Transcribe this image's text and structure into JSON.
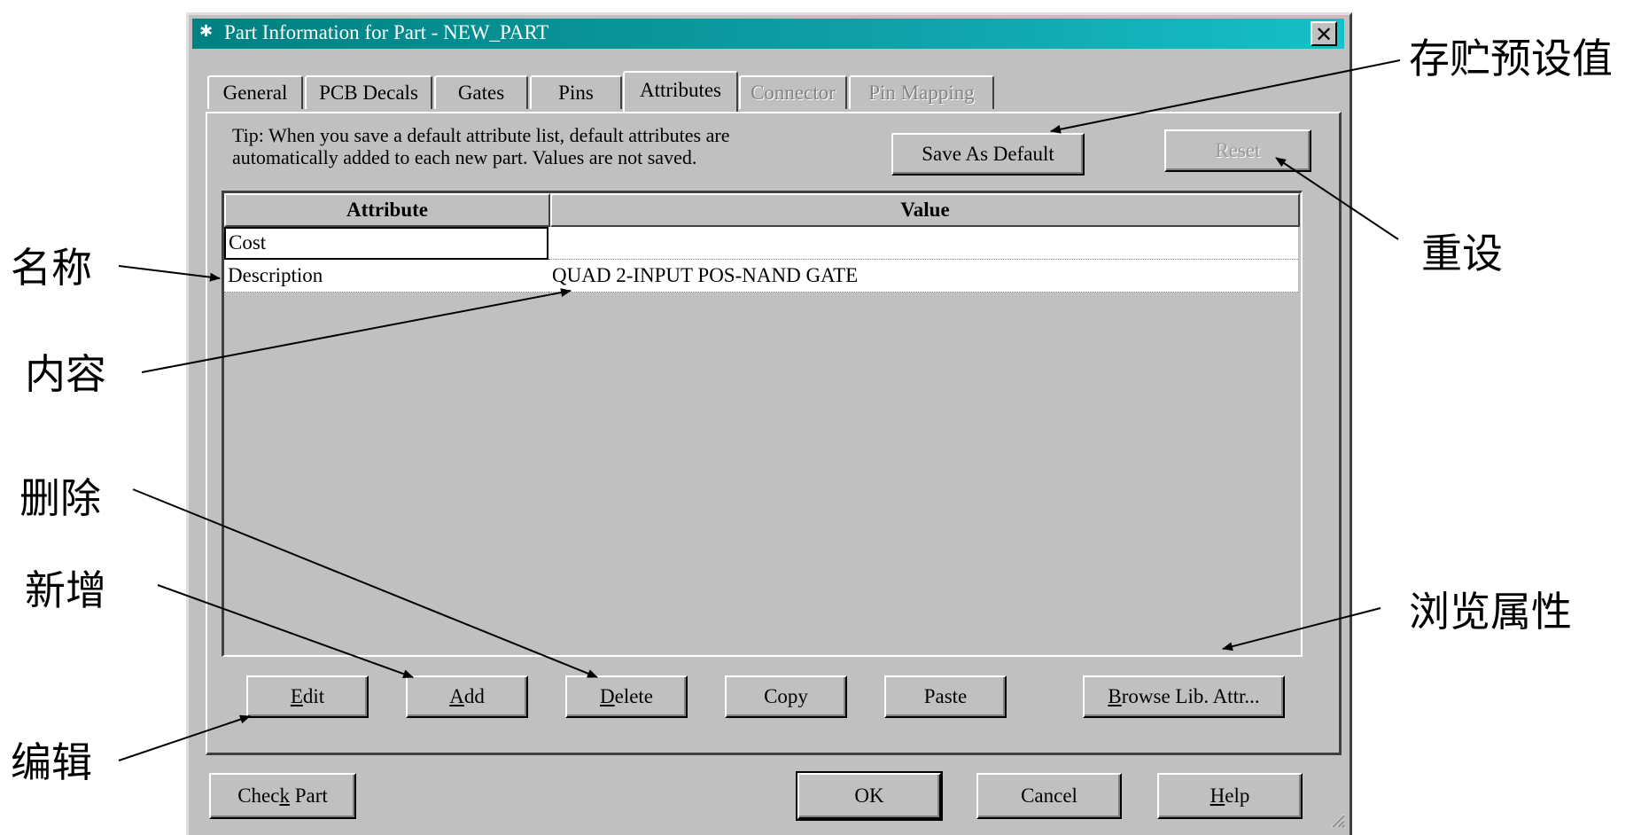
{
  "window": {
    "title": "Part Information for Part - NEW_PART",
    "close_glyph": "✕",
    "app_icon": "part-editor-icon"
  },
  "tabs": [
    {
      "label": "General",
      "state": "normal"
    },
    {
      "label": "PCB Decals",
      "state": "normal"
    },
    {
      "label": "Gates",
      "state": "normal"
    },
    {
      "label": "Pins",
      "state": "normal"
    },
    {
      "label": "Attributes",
      "state": "active"
    },
    {
      "label": "Connector",
      "state": "disabled"
    },
    {
      "label": "Pin Mapping",
      "state": "disabled"
    }
  ],
  "tip": {
    "line1": "Tip: When you save a default attribute list, default attributes are",
    "line2": "automatically added to each new part. Values are not saved."
  },
  "top_buttons": {
    "save_default": "Save As Default",
    "reset": "Reset"
  },
  "grid": {
    "columns": [
      "Attribute",
      "Value"
    ],
    "rows": [
      {
        "attribute": "Cost",
        "value": ""
      },
      {
        "attribute": "Description",
        "value": "QUAD 2-INPUT POS-NAND GATE"
      }
    ]
  },
  "actions": {
    "edit": {
      "mnemonic": "E",
      "rest": "dit"
    },
    "add": {
      "mnemonic": "A",
      "rest": "dd"
    },
    "delete": {
      "mnemonic": "D",
      "rest": "elete"
    },
    "copy": "Copy",
    "paste": "Paste",
    "browse": {
      "mnemonic": "B",
      "rest": "rowse Lib. Attr..."
    }
  },
  "footer": {
    "check_pre": "Chec",
    "check_mnemonic": "k",
    "check_post": " Part",
    "ok": "OK",
    "cancel": "Cancel",
    "help": {
      "mnemonic": "H",
      "rest": "elp"
    }
  },
  "annotations": {
    "save_default": "存贮预设值",
    "reset": "重设",
    "name": "名称",
    "content": "内容",
    "delete": "删除",
    "add": "新增",
    "browse": "浏览属性",
    "edit": "编辑"
  },
  "colors": {
    "dialog_face": "#c0c0c0",
    "title_gradient_start": "#008080",
    "title_gradient_end": "#16c0c8",
    "disabled_text": "#848484"
  }
}
